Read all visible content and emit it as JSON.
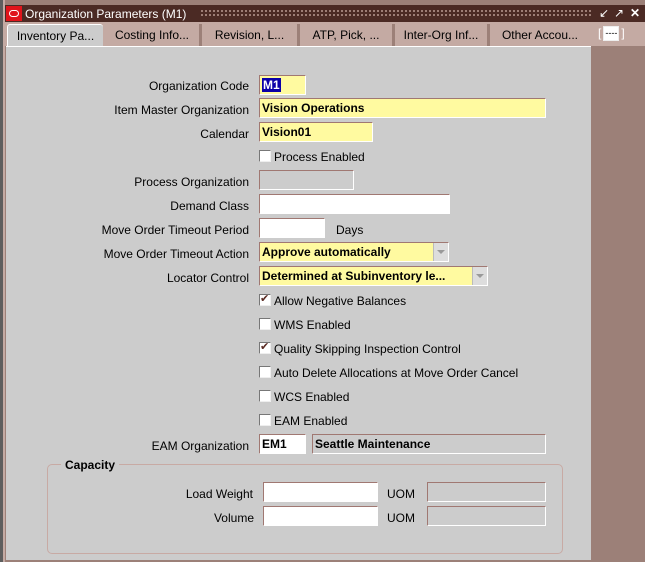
{
  "window": {
    "title": "Organization Parameters (M1)",
    "controls": [
      "minimize-icon",
      "maximize-icon",
      "close-icon"
    ]
  },
  "tabs": [
    {
      "label": "Inventory Pa...",
      "active": true
    },
    {
      "label": "Costing Info...",
      "active": false
    },
    {
      "label": "Revision, L...",
      "active": false
    },
    {
      "label": "ATP, Pick, ...",
      "active": false
    },
    {
      "label": "Inter-Org Inf...",
      "active": false
    },
    {
      "label": "Other Accou...",
      "active": false
    }
  ],
  "tab_overflow": {
    "left": "[",
    "value": "----",
    "right": "]"
  },
  "form": {
    "org_code": {
      "label": "Organization Code",
      "value": "M1"
    },
    "item_master": {
      "label": "Item Master Organization",
      "value": "Vision Operations"
    },
    "calendar": {
      "label": "Calendar",
      "value": "Vision01"
    },
    "process_enabled": {
      "label": "Process Enabled",
      "checked": false
    },
    "process_org": {
      "label": "Process Organization",
      "value": ""
    },
    "demand_class": {
      "label": "Demand Class",
      "value": ""
    },
    "timeout_period": {
      "label": "Move Order Timeout Period",
      "value": "",
      "unit": "Days"
    },
    "timeout_action": {
      "label": "Move Order Timeout Action",
      "value": "Approve automatically"
    },
    "locator_control": {
      "label": "Locator Control",
      "value": "Determined at Subinventory le..."
    },
    "checkboxes": [
      {
        "label": "Allow Negative Balances",
        "checked": true
      },
      {
        "label": "WMS Enabled",
        "checked": false
      },
      {
        "label": "Quality Skipping Inspection Control",
        "checked": true
      },
      {
        "label": "Auto Delete Allocations at Move Order Cancel",
        "checked": false
      },
      {
        "label": "WCS Enabled",
        "checked": false
      },
      {
        "label": "EAM Enabled",
        "checked": false
      }
    ],
    "eam_org": {
      "label": "EAM Organization",
      "code": "EM1",
      "name": "Seattle Maintenance"
    }
  },
  "capacity": {
    "title": "Capacity",
    "load_weight": {
      "label": "Load Weight",
      "value": "",
      "uom_label": "UOM",
      "uom": ""
    },
    "volume": {
      "label": "Volume",
      "value": "",
      "uom_label": "UOM",
      "uom": ""
    }
  }
}
